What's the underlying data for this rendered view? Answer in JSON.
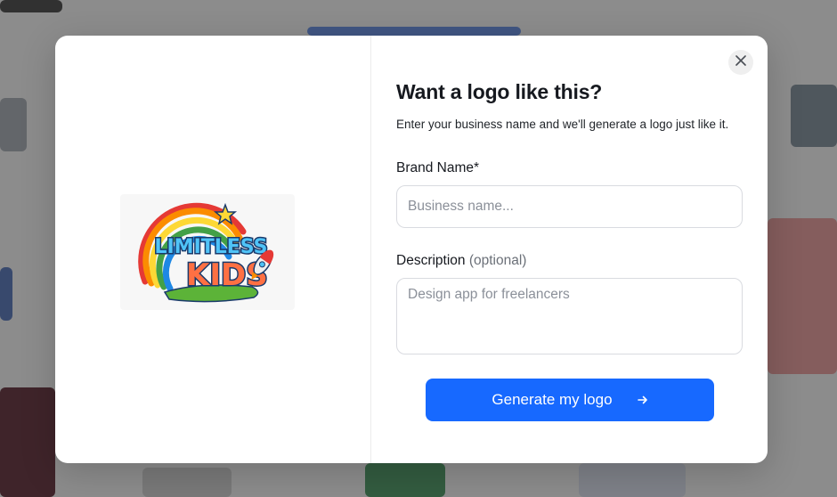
{
  "modal": {
    "title": "Want a logo like this?",
    "subtitle": "Enter your business name and we'll generate a logo just like it.",
    "preview_logo": {
      "text_line1": "LIMITLESS",
      "text_line2": "KIDS"
    },
    "brand_field": {
      "label": "Brand Name*",
      "placeholder": "Business name...",
      "value": ""
    },
    "description_field": {
      "label": "Description",
      "optional_tag": "(optional)",
      "placeholder": "Design app for freelancers",
      "value": ""
    },
    "generate_button": {
      "label": "Generate my logo"
    },
    "icons": {
      "close": "close-icon",
      "arrow": "arrow-right-icon"
    }
  },
  "colors": {
    "accent": "#1769ff",
    "overlay": "#5a5a5a",
    "text": "#16191f"
  }
}
